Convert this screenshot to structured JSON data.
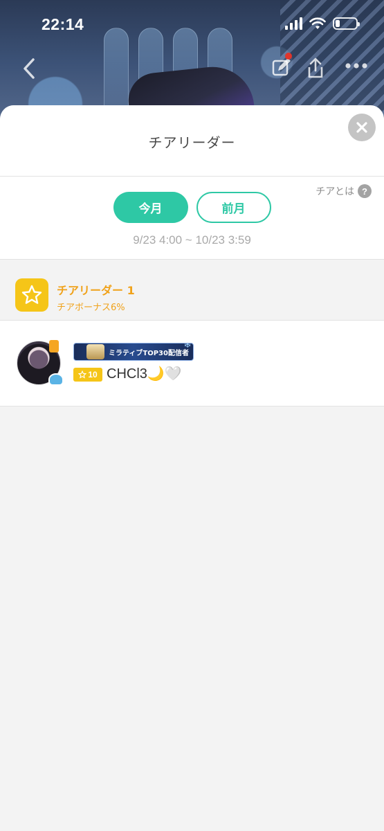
{
  "status_bar": {
    "time": "22:14",
    "battery_level": 0.2
  },
  "sheet": {
    "title": "チアリーダー",
    "help_label": "チアとは",
    "help_icon_text": "?",
    "tabs": [
      {
        "label": "今月",
        "active": true
      },
      {
        "label": "前月",
        "active": false
      }
    ],
    "period_range": "9/23 4:00 ~ 10/23 3:59",
    "leader": {
      "title": "チアリーダー 1",
      "bonus": "チアボーナス6%"
    },
    "user": {
      "ranking_banner": "ミラティブTOP30配信者",
      "level": "10",
      "name": "CHCl3🌙🤍"
    }
  },
  "colors": {
    "accent": "#2ec8a5",
    "gold": "#f0a21a",
    "badge_yellow": "#f5c518"
  },
  "icons": [
    "back-icon",
    "edit-icon",
    "share-icon",
    "more-icon",
    "close-icon",
    "star-icon",
    "help-icon",
    "wifi-icon",
    "signal-icon",
    "battery-icon"
  ]
}
